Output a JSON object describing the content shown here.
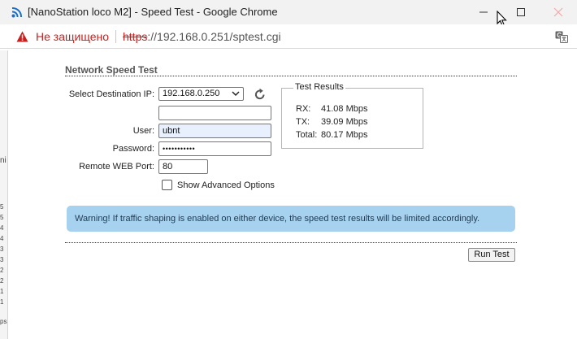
{
  "window": {
    "title": "[NanoStation loco M2] - Speed Test - Google Chrome"
  },
  "address_bar": {
    "security_text": "Не защищено",
    "url_scheme": "https",
    "url_rest": "://192.168.0.251/sptest.cgi"
  },
  "background_window": {
    "text_fragments": [
      "ni",
      "5",
      "5",
      "4",
      "4",
      "3",
      "3",
      "2",
      "2",
      "1",
      "1",
      "ps"
    ]
  },
  "speed_test": {
    "section_title": "Network Speed Test",
    "destination_label": "Select Destination IP:",
    "destination_selected": "192.168.0.250",
    "user_label": "User:",
    "user_value": "ubnt",
    "password_label": "Password:",
    "password_value": "•••••••••••",
    "port_label": "Remote WEB Port:",
    "port_value": "80",
    "advanced_label": "Show Advanced Options",
    "advanced_checked": false,
    "warning": "Warning! If traffic shaping is enabled on either device, the speed test results will be limited accordingly.",
    "run_label": "Run Test"
  },
  "results": {
    "legend": "Test Results",
    "rows": [
      {
        "label": "RX:",
        "value": "41.08 Mbps"
      },
      {
        "label": "TX:",
        "value": "39.09 Mbps"
      },
      {
        "label": "Total:",
        "value": "80.17 Mbps"
      }
    ]
  },
  "colors": {
    "warning_bg": "#a6d2f0",
    "insecure_red": "#c5221f",
    "autofill_bg": "#e8f0fe"
  }
}
